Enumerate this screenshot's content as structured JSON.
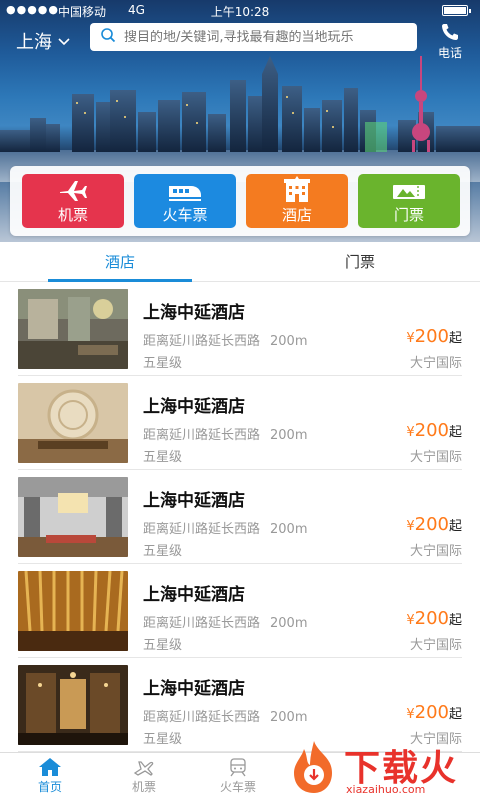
{
  "status_bar": {
    "signal": "●●●●●",
    "carrier": "中国移动",
    "network": "4G",
    "time": "上午10:28"
  },
  "header": {
    "city": "上海",
    "search_placeholder": "搜目的地/关键词,寻找最有趣的当地玩乐",
    "phone_label": "电话"
  },
  "categories": [
    {
      "label": "机票",
      "icon": "airplane-icon",
      "color": "#e5344d"
    },
    {
      "label": "火车票",
      "icon": "train-icon",
      "color": "#1c8ae0"
    },
    {
      "label": "酒店",
      "icon": "hotel-icon",
      "color": "#f47b20"
    },
    {
      "label": "门票",
      "icon": "ticket-icon",
      "color": "#6ab42d"
    }
  ],
  "tabs": [
    {
      "label": "酒店",
      "active": true
    },
    {
      "label": "门票",
      "active": false
    }
  ],
  "hotels": [
    {
      "name": "上海中延酒店",
      "address": "距离延川路延长西路",
      "distance": "200m",
      "level": "五星级",
      "price_symbol": "¥",
      "price": "200",
      "price_suffix": "起",
      "area": "大宁国际"
    },
    {
      "name": "上海中延酒店",
      "address": "距离延川路延长西路",
      "distance": "200m",
      "level": "五星级",
      "price_symbol": "¥",
      "price": "200",
      "price_suffix": "起",
      "area": "大宁国际"
    },
    {
      "name": "上海中延酒店",
      "address": "距离延川路延长西路",
      "distance": "200m",
      "level": "五星级",
      "price_symbol": "¥",
      "price": "200",
      "price_suffix": "起",
      "area": "大宁国际"
    },
    {
      "name": "上海中延酒店",
      "address": "距离延川路延长西路",
      "distance": "200m",
      "level": "五星级",
      "price_symbol": "¥",
      "price": "200",
      "price_suffix": "起",
      "area": "大宁国际"
    },
    {
      "name": "上海中延酒店",
      "address": "距离延川路延长西路",
      "distance": "200m",
      "level": "五星级",
      "price_symbol": "¥",
      "price": "200",
      "price_suffix": "起",
      "area": "大宁国际"
    }
  ],
  "bottom_nav": [
    {
      "label": "首页",
      "icon": "home-icon",
      "active": true
    },
    {
      "label": "机票",
      "icon": "airplane-icon",
      "active": false
    },
    {
      "label": "火车票",
      "icon": "train-icon",
      "active": false
    }
  ],
  "watermark": {
    "text": "下载火",
    "sub": "xiazaihuo.com"
  },
  "colors": {
    "accent": "#1a8cd8",
    "price": "#ff7a1a",
    "watermark": "#e8322b"
  }
}
